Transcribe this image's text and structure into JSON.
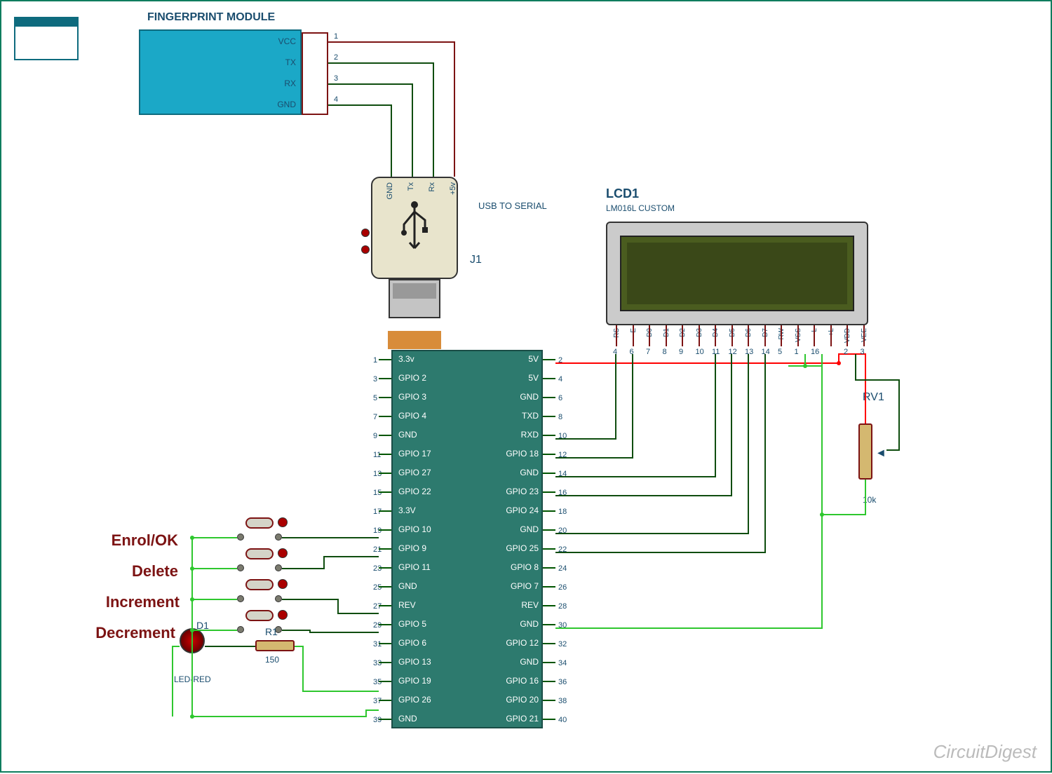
{
  "title": "FINGERPRINT MODULE",
  "watermark": "CircuitDigest",
  "fingerprint": {
    "pins": [
      {
        "label": "VCC",
        "num": "1"
      },
      {
        "label": "TX",
        "num": "2"
      },
      {
        "label": "RX",
        "num": "3"
      },
      {
        "label": "GND",
        "num": "4"
      }
    ]
  },
  "usb": {
    "label": "USB TO SERIAL",
    "ref": "J1",
    "pins": [
      "GND",
      "Tx",
      "Rx",
      "+5v"
    ]
  },
  "lcd": {
    "ref": "LCD1",
    "part": "LM016L CUSTOM",
    "pins": [
      {
        "label": "RS",
        "num": "4"
      },
      {
        "label": "E",
        "num": "6"
      },
      {
        "label": "D0",
        "num": "7"
      },
      {
        "label": "D1",
        "num": "8"
      },
      {
        "label": "D2",
        "num": "9"
      },
      {
        "label": "D3",
        "num": "10"
      },
      {
        "label": "D4",
        "num": "11"
      },
      {
        "label": "D5",
        "num": "12"
      },
      {
        "label": "D6",
        "num": "13"
      },
      {
        "label": "D7",
        "num": "14"
      },
      {
        "label": "RW",
        "num": "5"
      },
      {
        "label": "VSS",
        "num": "1"
      },
      {
        "label": "-L",
        "num": "16"
      },
      {
        "label": "+L",
        "num": ""
      },
      {
        "label": "VDD",
        "num": "2"
      },
      {
        "label": "VEE",
        "num": "3"
      }
    ]
  },
  "pi": {
    "left": [
      {
        "num": "1",
        "label": "3.3v"
      },
      {
        "num": "3",
        "label": "GPIO 2"
      },
      {
        "num": "5",
        "label": "GPIO 3"
      },
      {
        "num": "7",
        "label": "GPIO 4"
      },
      {
        "num": "9",
        "label": "GND"
      },
      {
        "num": "11",
        "label": "GPIO 17"
      },
      {
        "num": "13",
        "label": "GPIO 27"
      },
      {
        "num": "15",
        "label": "GPIO 22"
      },
      {
        "num": "17",
        "label": "3.3V"
      },
      {
        "num": "19",
        "label": "GPIO 10"
      },
      {
        "num": "21",
        "label": "GPIO 9"
      },
      {
        "num": "23",
        "label": "GPIO 11"
      },
      {
        "num": "25",
        "label": "GND"
      },
      {
        "num": "27",
        "label": "REV"
      },
      {
        "num": "29",
        "label": "GPIO 5"
      },
      {
        "num": "31",
        "label": "GPIO 6"
      },
      {
        "num": "33",
        "label": "GPIO 13"
      },
      {
        "num": "35",
        "label": "GPIO 19"
      },
      {
        "num": "37",
        "label": "GPIO 26"
      },
      {
        "num": "39",
        "label": "GND"
      }
    ],
    "right": [
      {
        "num": "2",
        "label": "5V"
      },
      {
        "num": "4",
        "label": "5V"
      },
      {
        "num": "6",
        "label": "GND"
      },
      {
        "num": "8",
        "label": "TXD"
      },
      {
        "num": "10",
        "label": "RXD"
      },
      {
        "num": "12",
        "label": "GPIO 18"
      },
      {
        "num": "14",
        "label": "GND"
      },
      {
        "num": "16",
        "label": "GPIO 23"
      },
      {
        "num": "18",
        "label": "GPIO 24"
      },
      {
        "num": "20",
        "label": "GND"
      },
      {
        "num": "22",
        "label": "GPIO 25"
      },
      {
        "num": "24",
        "label": "GPIO 8"
      },
      {
        "num": "26",
        "label": "GPIO 7"
      },
      {
        "num": "28",
        "label": "REV"
      },
      {
        "num": "30",
        "label": "GND"
      },
      {
        "num": "32",
        "label": "GPIO 12"
      },
      {
        "num": "34",
        "label": "GND"
      },
      {
        "num": "36",
        "label": "GPIO 16"
      },
      {
        "num": "38",
        "label": "GPIO 20"
      },
      {
        "num": "40",
        "label": "GPIO 21"
      }
    ]
  },
  "buttons": [
    "Enrol/OK",
    "Delete",
    "Increment",
    "Decrement"
  ],
  "led": {
    "ref": "D1",
    "part": "LED-RED"
  },
  "resistor": {
    "ref": "R1",
    "value": "150"
  },
  "pot": {
    "ref": "RV1",
    "value": "10k"
  }
}
